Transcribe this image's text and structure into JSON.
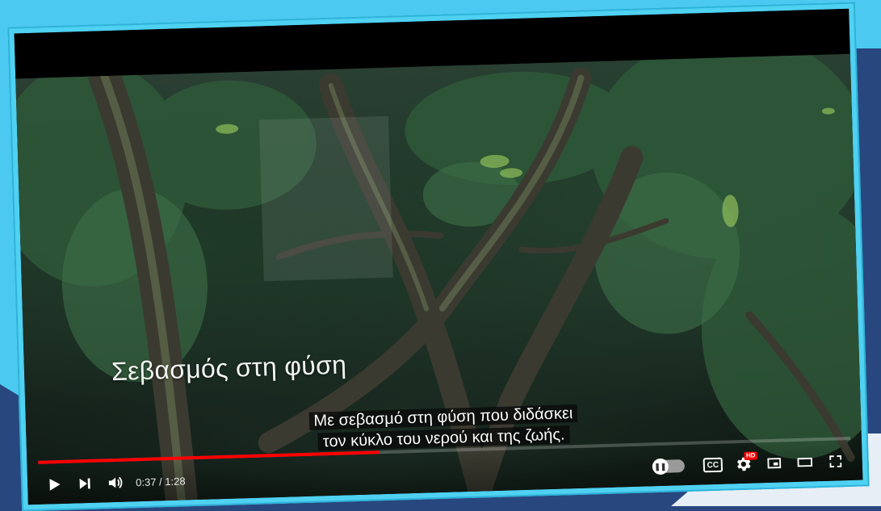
{
  "video": {
    "title_overlay": "Σεβασμός στη φύση",
    "subtitle_line1": "Με σεβασμό στη φύση που διδάσκει",
    "subtitle_line2": "τον κύκλο του νερού και της ζωής."
  },
  "player": {
    "time_current": "0:37",
    "time_total": "1:28",
    "time_display": "0:37 / 1:28",
    "progress": 0.42,
    "cc_label": "CC",
    "hd_label": "HD",
    "autoplay_state": "on"
  },
  "icons": {
    "play": "play-icon",
    "next": "next-icon",
    "volume": "volume-icon",
    "autoplay": "autoplay-toggle-icon",
    "captions": "captions-icon",
    "settings": "gear-icon",
    "miniplayer": "miniplayer-icon",
    "theater": "theater-icon",
    "fullscreen": "fullscreen-icon"
  },
  "colors": {
    "progress": "#ff0000",
    "frame": "#4fd1f2",
    "background_cyan": "#4cc9f0",
    "background_navy": "#28477f"
  }
}
